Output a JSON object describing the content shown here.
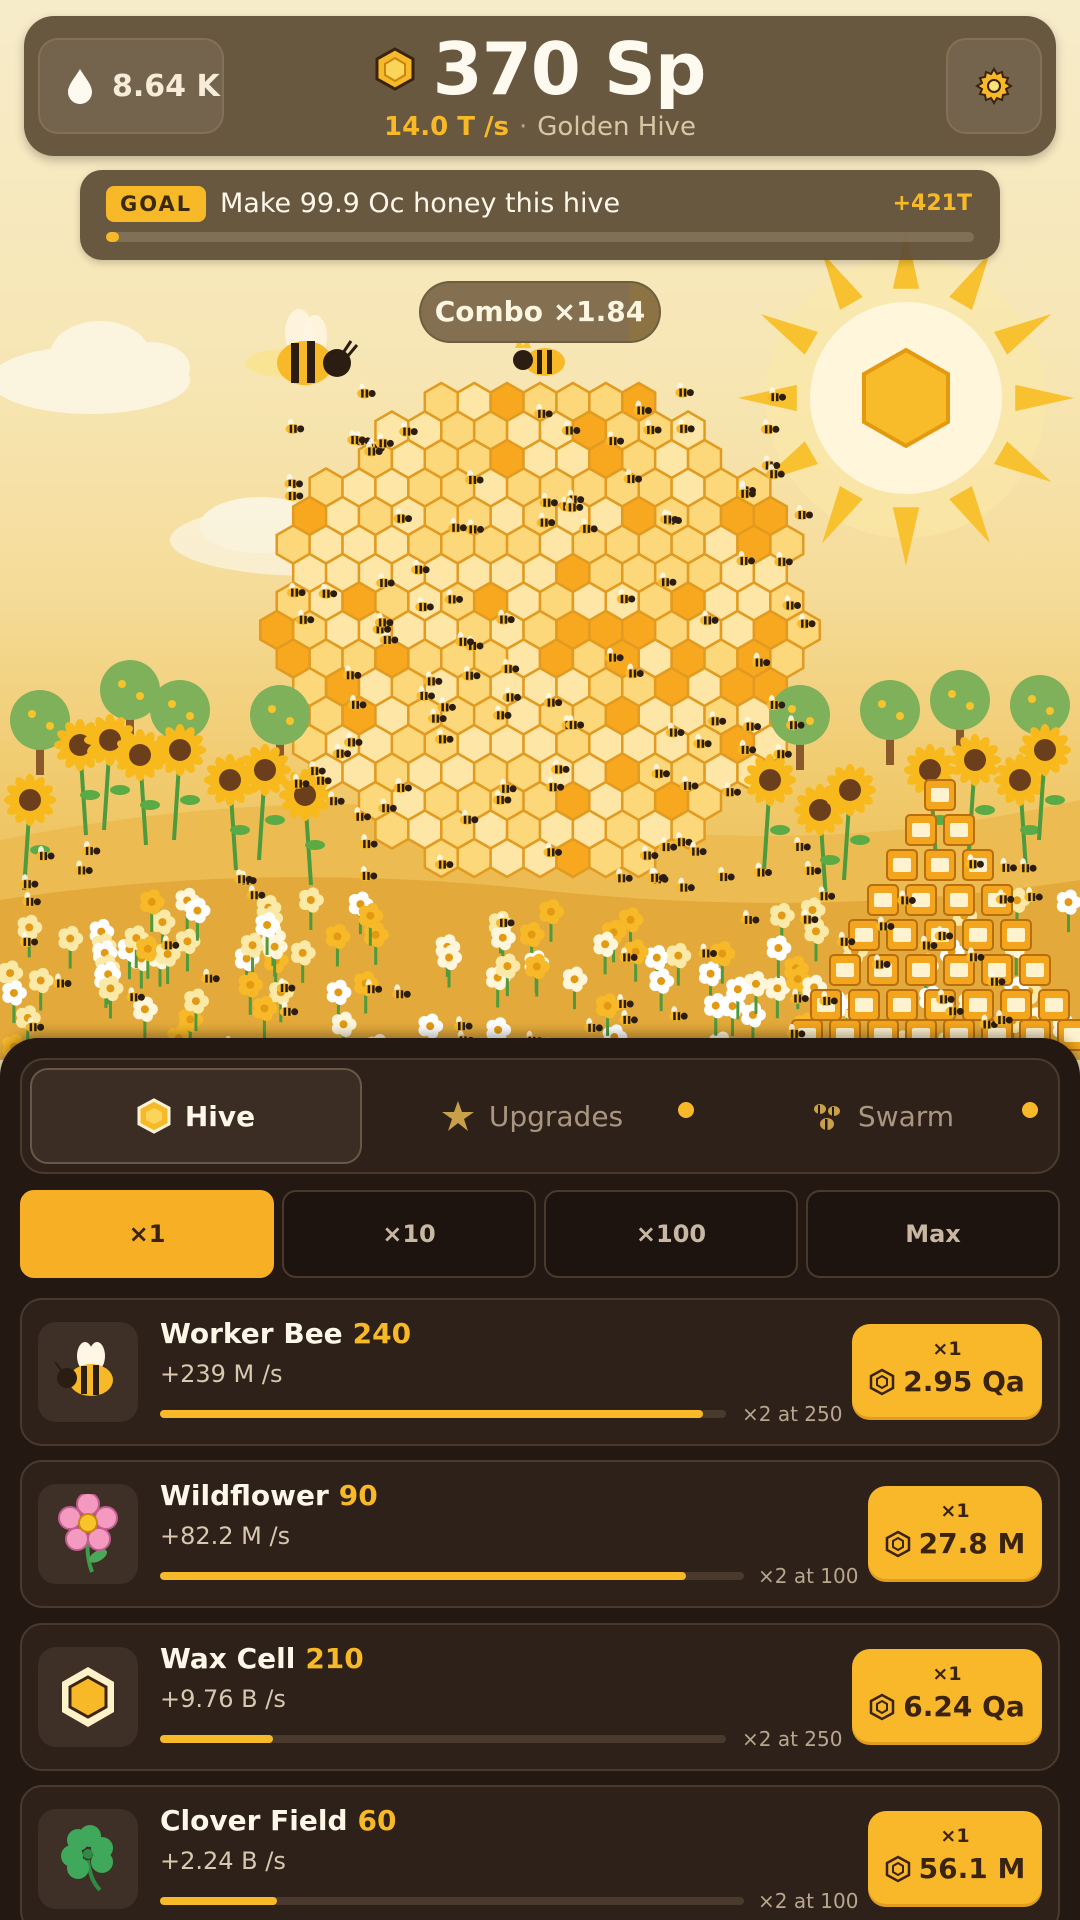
{
  "resources": {
    "nectar": "8.64 K"
  },
  "honey": {
    "amount": "370 Sp",
    "rate": "14.0 T /s",
    "separator": "·",
    "hive_name": "Golden Hive"
  },
  "goal": {
    "badge": "GOAL",
    "text": "Make 99.9 Oc honey this hive",
    "reward": "+421T",
    "progress": 0.015
  },
  "combo": {
    "label": "Combo ×1.84"
  },
  "tabs": [
    {
      "label": "Hive",
      "icon": "hex-coin-icon",
      "active": true
    },
    {
      "label": "Upgrades",
      "icon": "star-icon",
      "notify": true
    },
    {
      "label": "Swarm",
      "icon": "bees-icon",
      "notify": true
    }
  ],
  "multipliers": [
    "×1",
    "×10",
    "×100",
    "Max"
  ],
  "active_multiplier": "×1",
  "items": [
    {
      "name": "Worker Bee",
      "count": "240",
      "rate": "+239 M /s",
      "progress": 0.96,
      "next": "×2 at 250",
      "qty": "×1",
      "price": "2.95 Qa",
      "icon": "worker-bee-icon"
    },
    {
      "name": "Wildflower",
      "count": "90",
      "rate": "+82.2 M /s",
      "progress": 0.9,
      "next": "×2 at 100",
      "qty": "×1",
      "price": "27.8 M",
      "icon": "flower-icon"
    },
    {
      "name": "Wax Cell",
      "count": "210",
      "rate": "+9.76 B /s",
      "progress": 0.2,
      "next": "×2 at 250",
      "qty": "×1",
      "price": "6.24 Qa",
      "icon": "wax-cell-icon"
    },
    {
      "name": "Clover Field",
      "count": "60",
      "rate": "+2.24 B /s",
      "progress": 0.2,
      "next": "×2 at 100",
      "qty": "×1",
      "price": "56.1 M",
      "icon": "clover-icon"
    }
  ],
  "colors": {
    "accent": "#f7b928",
    "panel": "#231812",
    "card": "#2e2119"
  }
}
